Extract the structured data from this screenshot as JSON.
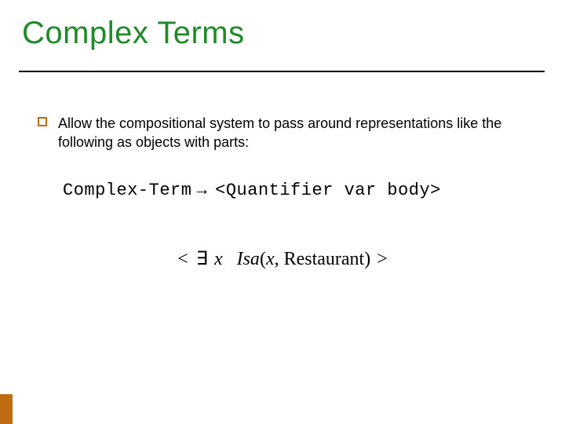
{
  "title": "Complex Terms",
  "bullet": "Allow the compositional system to pass around representations like the following as objects with parts:",
  "grammar": {
    "lhs": "Complex-Term",
    "arrow": "→",
    "rhs": "<Quantifier var body>"
  },
  "formula": {
    "open": "<",
    "exists": "∃",
    "var": "x",
    "pred": "Isa",
    "lparen": "(",
    "arg1": "x",
    "comma": ",",
    "arg2": "Restaurant",
    "rparen": ")",
    "close": ">"
  }
}
